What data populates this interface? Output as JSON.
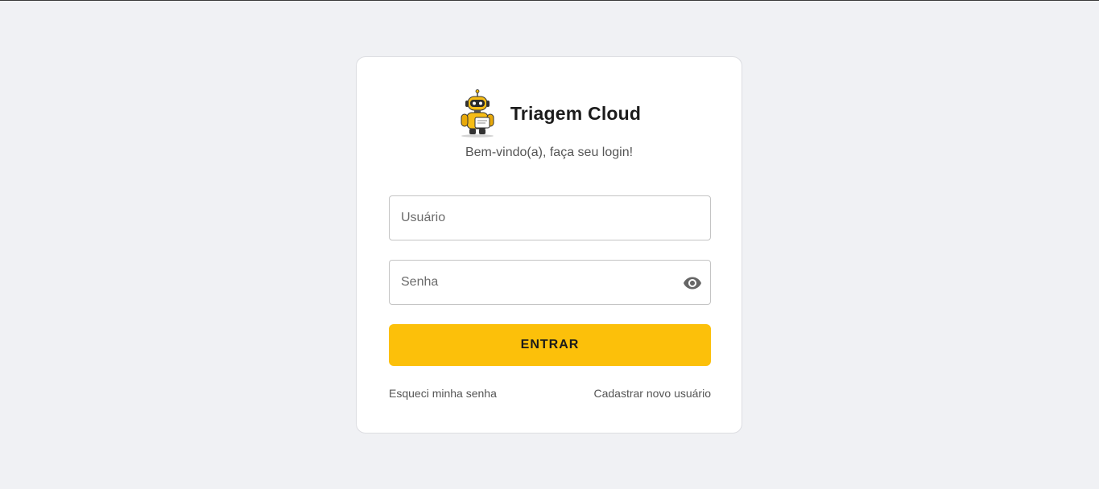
{
  "app": {
    "title": "Triagem Cloud",
    "subtitle": "Bem-vindo(a), faça seu login!",
    "logo_icon": "robot-mascot-icon"
  },
  "form": {
    "username_placeholder": "Usuário",
    "password_placeholder": "Senha",
    "password_toggle_icon": "eye-icon",
    "submit_label": "ENTRAR"
  },
  "links": {
    "forgot_password": "Esqueci minha senha",
    "register": "Cadastrar novo usuário"
  },
  "colors": {
    "background": "#f0f1f4",
    "card": "#ffffff",
    "accent": "#fcc00a"
  }
}
